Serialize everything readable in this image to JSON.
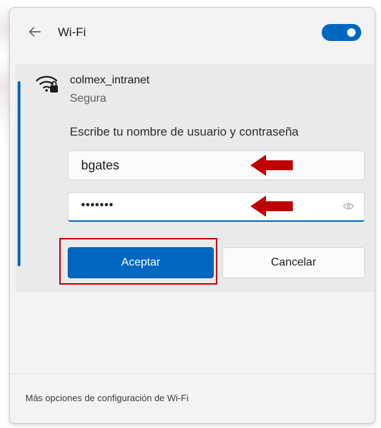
{
  "header": {
    "title": "Wi-Fi",
    "toggle_state": "on"
  },
  "network": {
    "name": "colmex_intranet",
    "status": "Segura",
    "prompt": "Escribe tu nombre de usuario y contraseña",
    "username_value": "bgates",
    "password_value": "•••••••",
    "ok_label": "Aceptar",
    "cancel_label": "Cancelar"
  },
  "footer": {
    "link_label": "Más opciones de configuración de Wi-Fi"
  },
  "colors": {
    "accent": "#0067c0",
    "annotation": "#c00000"
  },
  "icons": [
    "back-arrow-icon",
    "wifi-secure-icon",
    "reveal-password-icon"
  ]
}
